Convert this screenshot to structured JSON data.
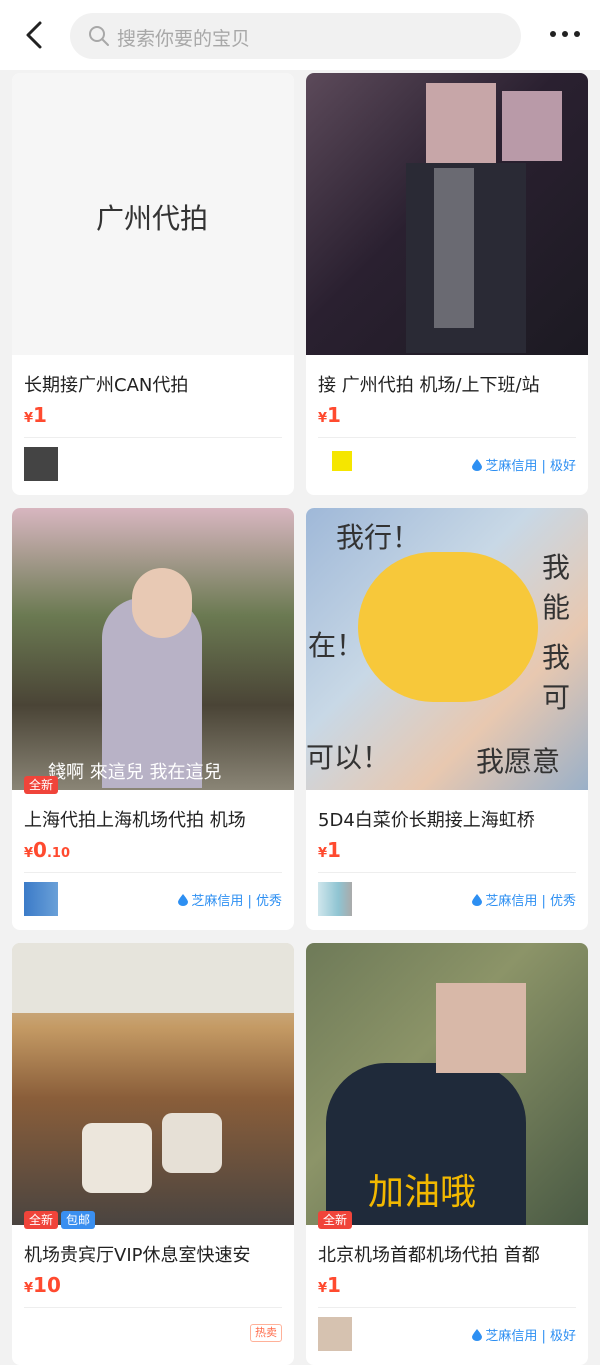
{
  "header": {
    "search_placeholder": "搜索你要的宝贝",
    "back_icon": "back-icon",
    "more_icon": "more-icon"
  },
  "cards": [
    {
      "image_text": "广州代拍",
      "title": "长期接广州CAN代拍",
      "price_symbol": "¥",
      "price_int": "1",
      "price_dec": ""
    },
    {
      "title": "接 广州代拍 机场/上下班/站",
      "price_symbol": "¥",
      "price_int": "1",
      "price_dec": "",
      "credit": "芝麻信用 | 极好"
    },
    {
      "image_caption": "錢啊 來這兒 我在這兒",
      "tags": [
        "全新"
      ],
      "title": "上海代拍上海机场代拍 机场",
      "price_symbol": "¥",
      "price_int": "0",
      "price_dec": ".10",
      "credit": "芝麻信用 | 优秀"
    },
    {
      "image_texts": [
        "我行！",
        "我能",
        "在！",
        "我可",
        "可以！",
        "我愿意"
      ],
      "title": "5D4白菜价长期接上海虹桥",
      "price_symbol": "¥",
      "price_int": "1",
      "price_dec": "",
      "credit": "芝麻信用 | 优秀"
    },
    {
      "tags": [
        "全新",
        "包邮"
      ],
      "title": "机场贵宾厅VIP休息室快速安",
      "price_symbol": "¥",
      "price_int": "10",
      "price_dec": "",
      "hot": "热卖"
    },
    {
      "image_caption": "加油哦",
      "tags": [
        "全新"
      ],
      "title": "北京机场首都机场代拍 首都",
      "price_symbol": "¥",
      "price_int": "1",
      "price_dec": "",
      "credit": "芝麻信用 | 极好"
    }
  ],
  "colors": {
    "price": "#ff4a2f",
    "credit": "#2d8ff2",
    "tag_new": "#f0443a",
    "tag_ship": "#3a8ff0"
  }
}
